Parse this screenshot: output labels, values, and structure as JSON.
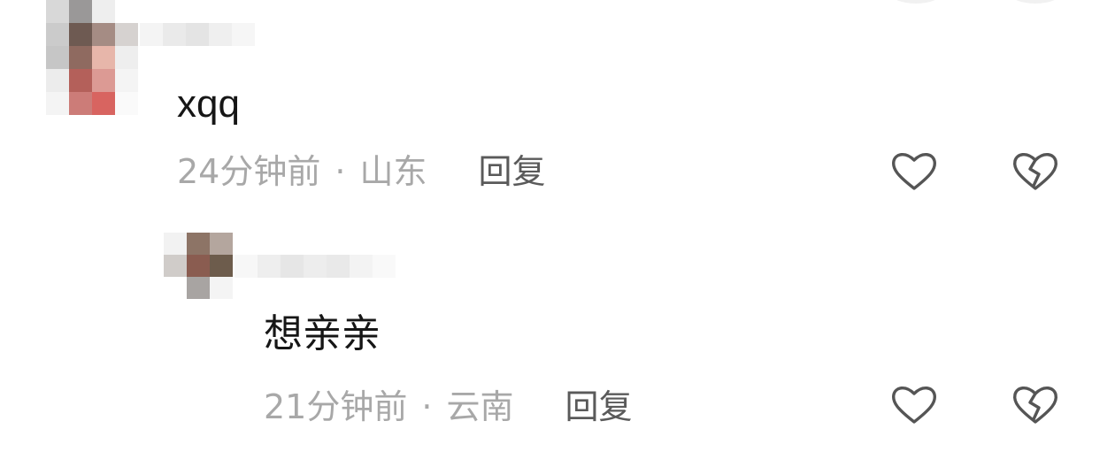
{
  "comments": [
    {
      "text": "xqq",
      "time": "24分钟前",
      "separator": "·",
      "location": "山东",
      "reply_label": "回复",
      "like_icon": "heart-outline-icon",
      "dislike_icon": "broken-heart-icon"
    },
    {
      "text": "想亲亲",
      "time": "21分钟前",
      "separator": "·",
      "location": "云南",
      "reply_label": "回复",
      "like_icon": "heart-outline-icon",
      "dislike_icon": "broken-heart-icon"
    }
  ],
  "colors": {
    "text_primary": "#161616",
    "text_meta": "#a8a8a8",
    "reply_button": "#5a5a5a",
    "icon_stroke": "#555555"
  }
}
